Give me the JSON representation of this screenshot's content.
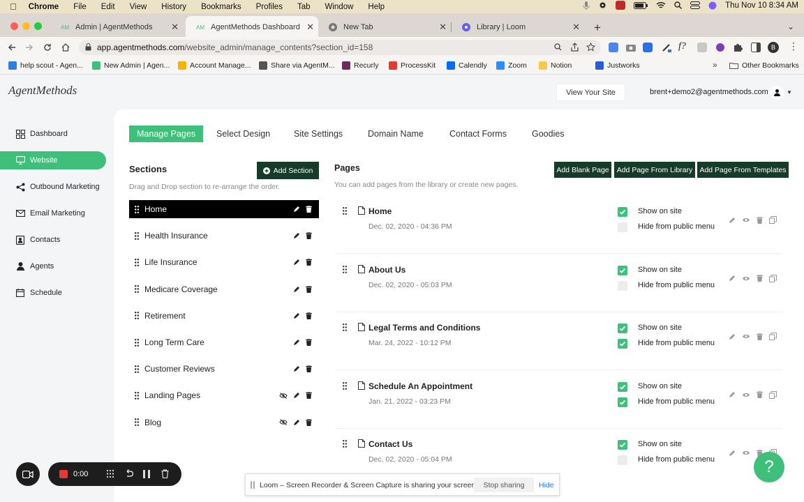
{
  "menubar": {
    "app": "Chrome",
    "items": [
      "File",
      "Edit",
      "View",
      "History",
      "Bookmarks",
      "Profiles",
      "Tab",
      "Window",
      "Help"
    ],
    "clock": "Thu Nov 10  8:34 AM"
  },
  "tabs": [
    {
      "title": "Admin | AgentMethods",
      "active": false
    },
    {
      "title": "AgentMethods Dashboard",
      "active": true
    },
    {
      "title": "New Tab",
      "active": false
    },
    {
      "title": "Library | Loom",
      "active": false
    }
  ],
  "url": {
    "host": "app.agentmethods.com",
    "path": "/website_admin/manage_contents?section_id=158"
  },
  "profile_initial": "B",
  "bookmarks": [
    {
      "label": "help scout - Agen...",
      "color": "#2f7de1"
    },
    {
      "label": "New Admin | Agen...",
      "color": "#3ec07b"
    },
    {
      "label": "Account Manage...",
      "color": "#f4b400"
    },
    {
      "label": "Share via AgentM...",
      "color": "#555555"
    },
    {
      "label": "Recurly",
      "color": "#6b2b5e"
    },
    {
      "label": "ProcessKit",
      "color": "#e53935"
    },
    {
      "label": "Calendly",
      "color": "#006bff"
    },
    {
      "label": "Zoom",
      "color": "#2d8cff"
    },
    {
      "label": "Notion",
      "color": "#f7c948"
    },
    {
      "label": "Justworks",
      "color": "#2b5bd7"
    }
  ],
  "other_bookmarks": "Other Bookmarks",
  "logo": "AgentMethods",
  "view_site": "View Your Site",
  "user_email": "brent+demo2@agentmethods.com",
  "sidebar": [
    {
      "label": "Dashboard",
      "icon": "dashboard-icon",
      "active": false
    },
    {
      "label": "Website",
      "icon": "monitor-icon",
      "active": true
    },
    {
      "label": "Outbound Marketing",
      "icon": "share-icon",
      "active": false
    },
    {
      "label": "Email Marketing",
      "icon": "envelope-icon",
      "active": false
    },
    {
      "label": "Contacts",
      "icon": "contacts-icon",
      "active": false
    },
    {
      "label": "Agents",
      "icon": "person-icon",
      "active": false
    },
    {
      "label": "Schedule",
      "icon": "calendar-icon",
      "active": false
    }
  ],
  "topnav": [
    "Manage Pages",
    "Select Design",
    "Site Settings",
    "Domain Name",
    "Contact Forms",
    "Goodies"
  ],
  "sections": {
    "title": "Sections",
    "subtitle": "Drag and Drop section to re-arrange the order.",
    "add_label": "Add Section",
    "items": [
      {
        "name": "Home",
        "active": true,
        "hidden": false
      },
      {
        "name": "Health Insurance",
        "active": false,
        "hidden": false
      },
      {
        "name": "Life Insurance",
        "active": false,
        "hidden": false
      },
      {
        "name": "Medicare Coverage",
        "active": false,
        "hidden": false
      },
      {
        "name": "Retirement",
        "active": false,
        "hidden": false
      },
      {
        "name": "Long Term Care",
        "active": false,
        "hidden": false
      },
      {
        "name": "Customer Reviews",
        "active": false,
        "hidden": false
      },
      {
        "name": "Landing Pages",
        "active": false,
        "hidden": true
      },
      {
        "name": "Blog",
        "active": false,
        "hidden": true
      }
    ]
  },
  "pages": {
    "title": "Pages",
    "subtitle": "You can add pages from the library or create new pages.",
    "buttons": [
      "Add Blank Page",
      "Add Page From Library",
      "Add Page From Templates"
    ],
    "show_label": "Show on site",
    "hide_label": "Hide from public menu",
    "items": [
      {
        "name": "Home",
        "date": "Dec. 02, 2020 - 04:36 PM",
        "show": true,
        "hide_menu": false
      },
      {
        "name": "About Us",
        "date": "Dec. 02, 2020 - 05:03 PM",
        "show": true,
        "hide_menu": false
      },
      {
        "name": "Legal Terms and Conditions",
        "date": "Mar. 24, 2022 - 10:12 PM",
        "show": true,
        "hide_menu": true
      },
      {
        "name": "Schedule An Appointment",
        "date": "Jan. 21, 2022 - 03:23 PM",
        "show": true,
        "hide_menu": true
      },
      {
        "name": "Contact Us",
        "date": "Dec. 02, 2020 - 05:04 PM",
        "show": true,
        "hide_menu": false
      }
    ]
  },
  "loom": {
    "timer": "0:00",
    "notice": "Loom – Screen Recorder & Screen Capture is sharing your screen.",
    "stop": "Stop sharing",
    "hide": "Hide"
  },
  "help": "?",
  "colors": {
    "accent": "#3ec07b",
    "dark_button": "#163b2a"
  }
}
